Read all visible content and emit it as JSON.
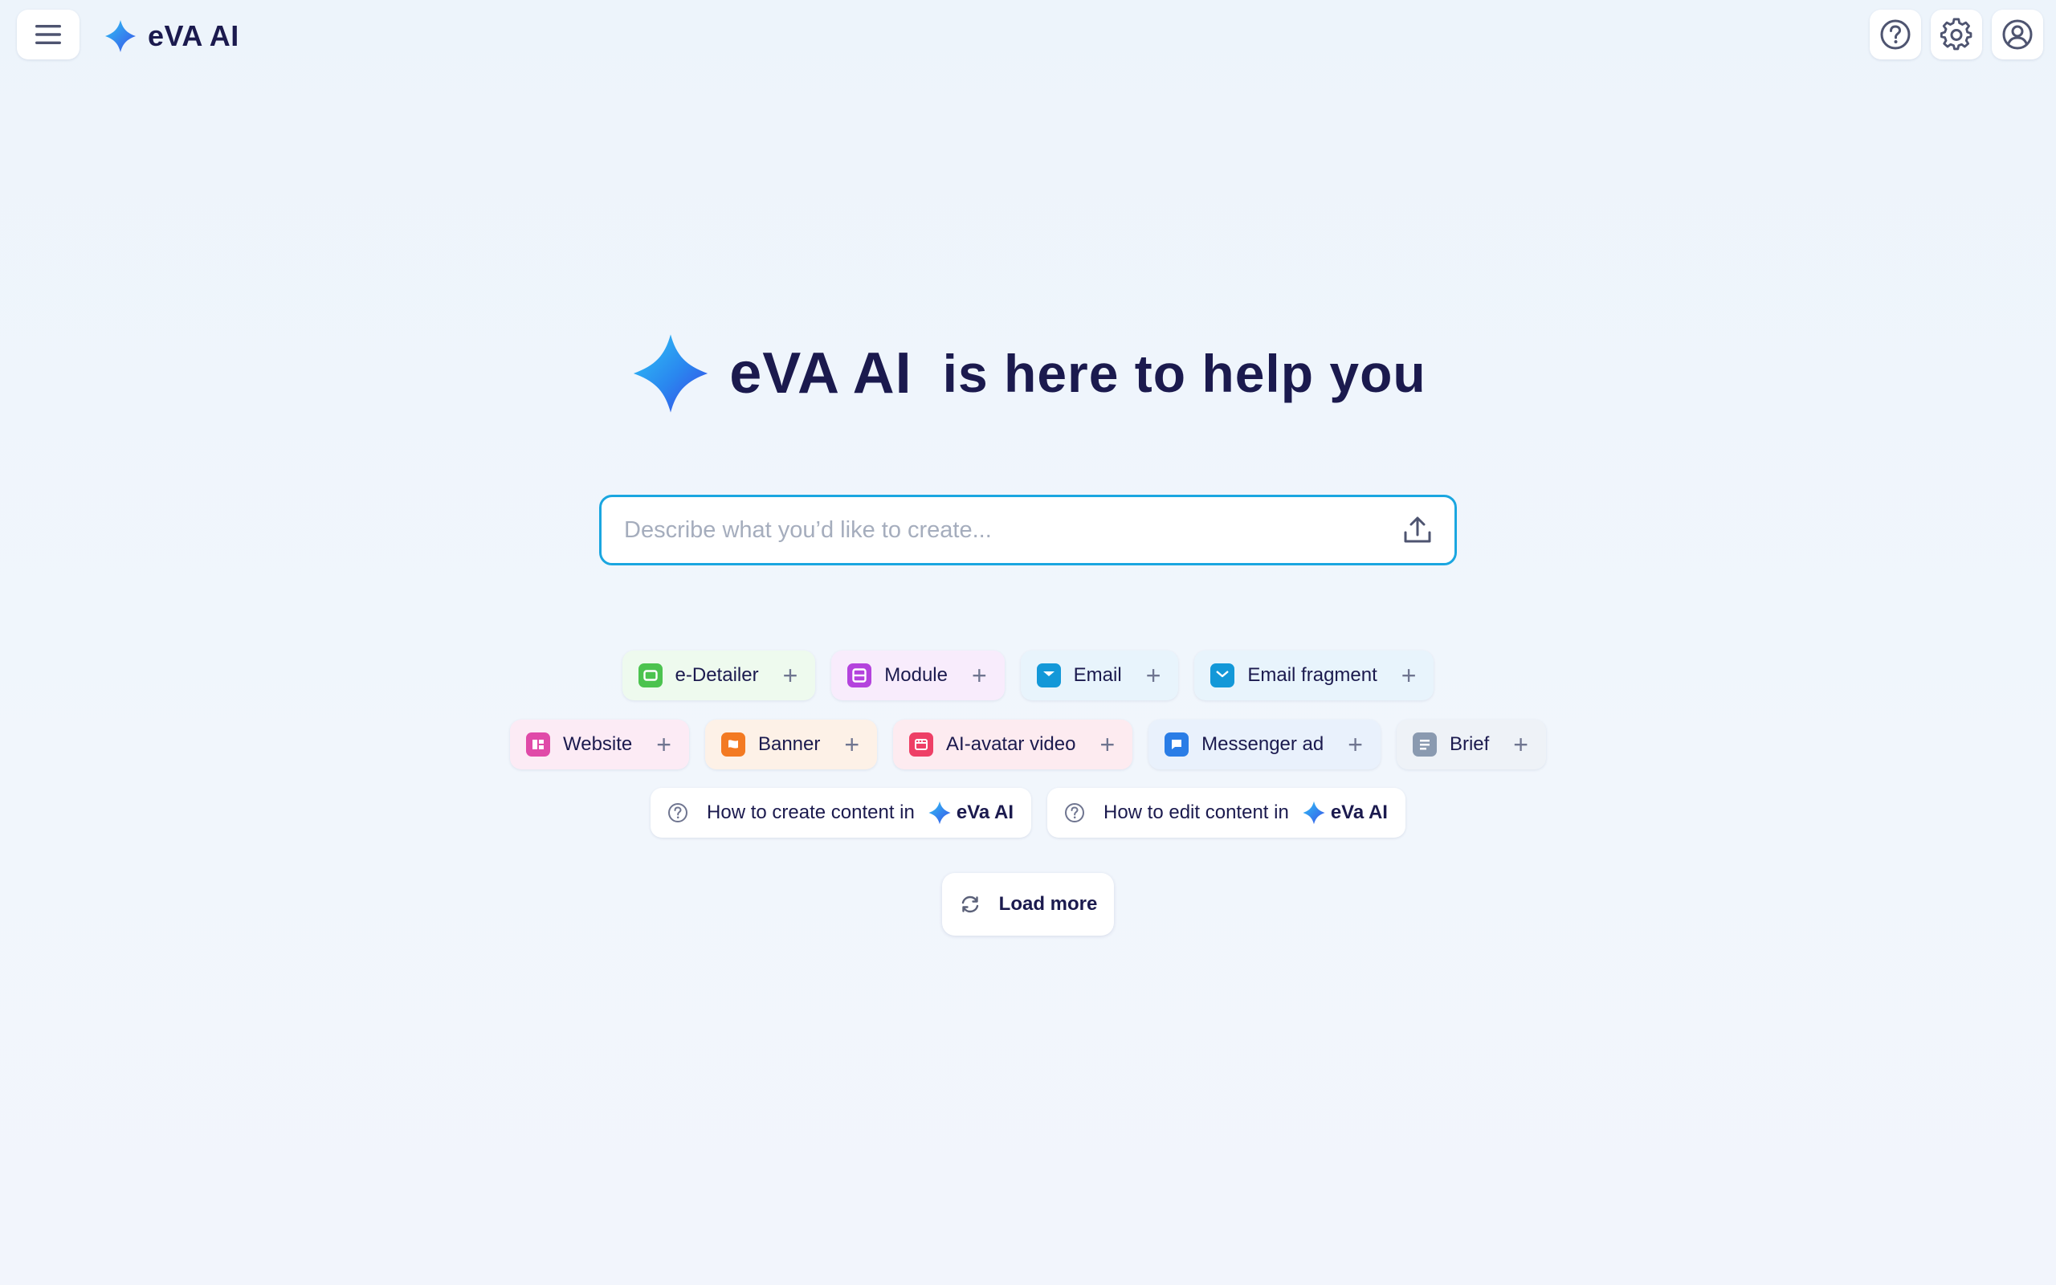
{
  "header": {
    "brand": "eVA AI",
    "icons": {
      "menu": "hamburger-icon",
      "help": "help-icon",
      "settings": "gear-icon",
      "account": "user-icon"
    }
  },
  "hero": {
    "brand": "eVA AI",
    "tagline": "is here to help you"
  },
  "prompt": {
    "placeholder": "Describe what you’d like to create...",
    "value": ""
  },
  "chips_row1": [
    {
      "label": "e-Detailer",
      "color": "#4cc34f",
      "bg": "#eefaee"
    },
    {
      "label": "Module",
      "color": "#b443dd",
      "bg": "#f8ecfc"
    },
    {
      "label": "Email",
      "color": "#1398d8",
      "bg": "#e8f4fc"
    },
    {
      "label": "Email fragment",
      "color": "#1398d8",
      "bg": "#e8f4fc"
    }
  ],
  "chips_row2": [
    {
      "label": "Website",
      "color": "#e04aa8",
      "bg": "#fcebf5"
    },
    {
      "label": "Banner",
      "color": "#f37a22",
      "bg": "#fdf1e7"
    },
    {
      "label": "AI-avatar video",
      "color": "#ee3f66",
      "bg": "#fdebf0"
    },
    {
      "label": "Messenger ad",
      "color": "#2a7de6",
      "bg": "#e9f1fc"
    },
    {
      "label": "Brief",
      "color": "#8a9ab0",
      "bg": "#eef2f7"
    }
  ],
  "help_links": [
    {
      "label": "How to create content in",
      "brand": "eVa AI"
    },
    {
      "label": "How to edit content in",
      "brand": "eVa AI"
    }
  ],
  "load_more": "Load more"
}
